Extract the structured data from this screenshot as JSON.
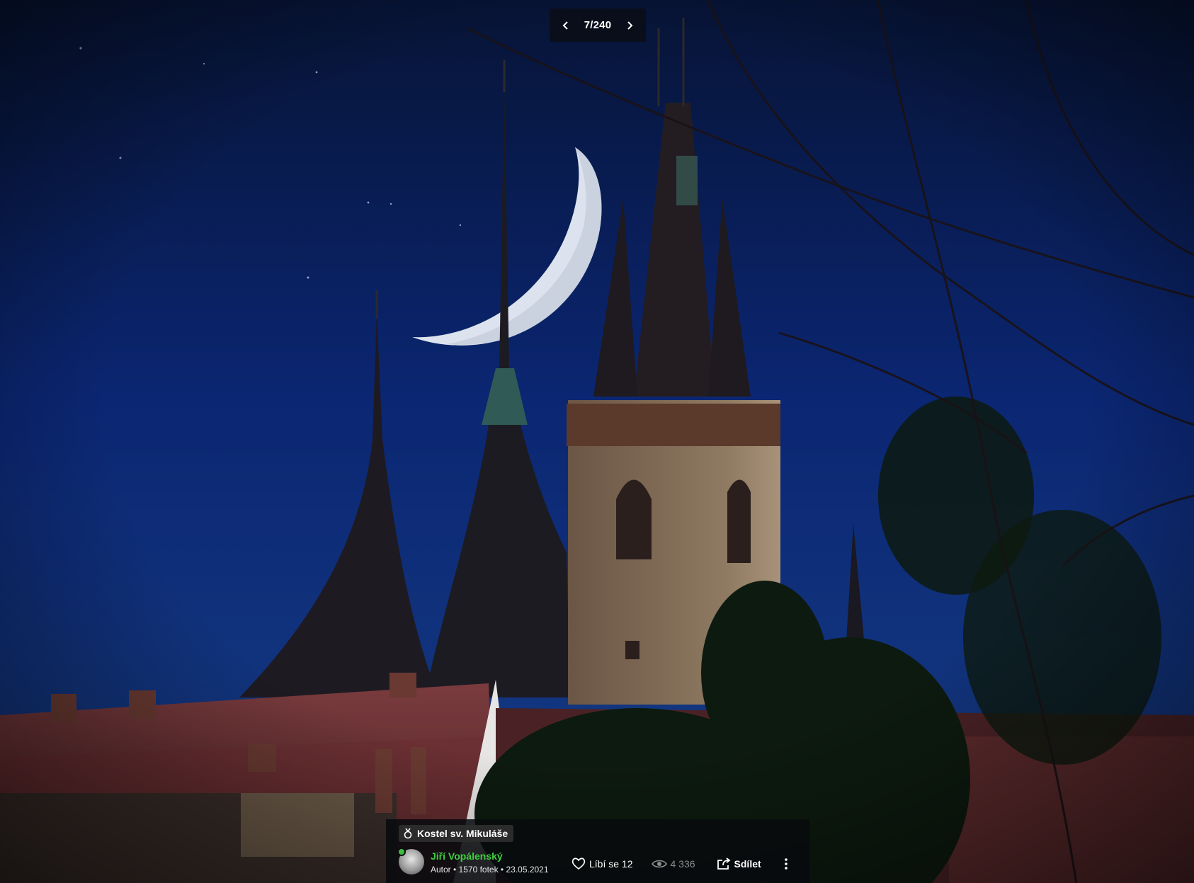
{
  "viewer": {
    "pager": {
      "current": "7/240",
      "prev_icon": "chevron-left-icon",
      "next_icon": "chevron-right-icon"
    }
  },
  "photo": {
    "title": "Kostel sv. Mikuláše",
    "author": "Jiří Vopálenský",
    "meta": "Autor • 1570 fotek • 23.05.2021",
    "likes_label": "Líbí se 12",
    "views": "4 336",
    "share_label": "Sdílet"
  },
  "colors": {
    "author": "#3fcf3f",
    "bar_bg": "#0a0c10",
    "sky": "#0b2a7a"
  }
}
